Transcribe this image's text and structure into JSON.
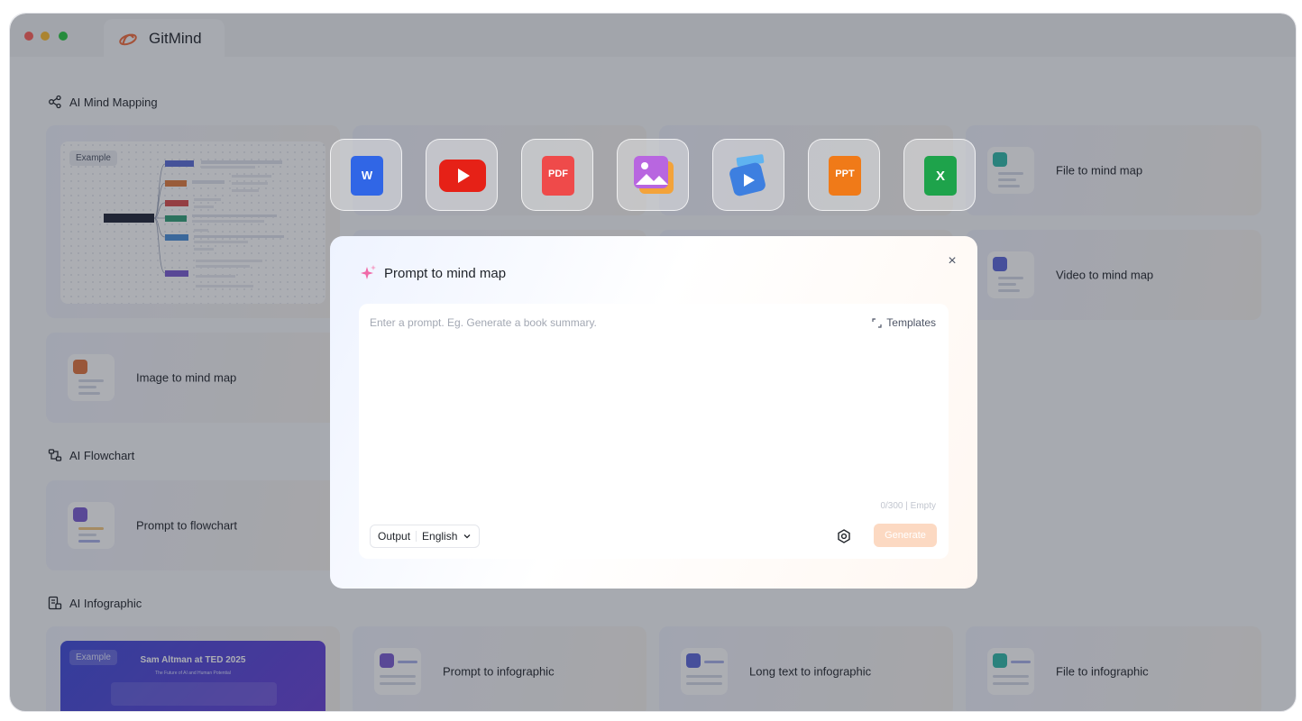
{
  "app": {
    "tab_title": "GitMind"
  },
  "sections": {
    "mind_mapping": "AI Mind Mapping",
    "flowchart": "AI Flowchart",
    "infographic": "AI Infographic"
  },
  "example": {
    "badge": "Example",
    "infographic_title": "Sam Altman at TED 2025",
    "infographic_sub": "The Future of AI and Human Potential"
  },
  "cards": {
    "file_to_mind_map": "File to mind map",
    "video_to_mind_map": "Video to mind map",
    "image_to_mind_map": "Image to mind map",
    "prompt_to_flowchart": "Prompt to flowchart",
    "prompt_to_infographic": "Prompt to infographic",
    "long_text_to_infographic": "Long text to infographic",
    "file_to_infographic": "File to infographic"
  },
  "float_icons": {
    "word": "W",
    "pdf": "PDF",
    "ppt": "PPT",
    "excel": "X"
  },
  "modal": {
    "title": "Prompt to mind map",
    "close": "×",
    "placeholder": "Enter a prompt. Eg. Generate a book summary.",
    "templates": "Templates",
    "counter": "0/300 | Empty",
    "output_label": "Output",
    "output_value": "English",
    "generate": "Generate"
  },
  "colors": {
    "accent_orange": "#f26b3a",
    "generate_disabled": "#fcd9c2",
    "overlay": "#262a37"
  }
}
